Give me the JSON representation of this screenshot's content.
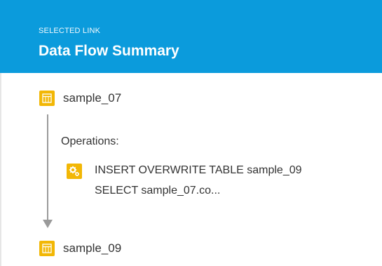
{
  "header": {
    "kicker": "SELECTED LINK",
    "title": "Data Flow Summary"
  },
  "source_table": {
    "name": "sample_07",
    "icon": "table-icon"
  },
  "operations": {
    "label": "Operations:",
    "items": [
      {
        "icon": "gears-icon",
        "line1": "INSERT OVERWRITE TABLE sample_09",
        "line2": "SELECT sample_07.co..."
      }
    ]
  },
  "target_table": {
    "name": "sample_09",
    "icon": "table-icon"
  },
  "colors": {
    "header_bg": "#0b9bdc",
    "icon_bg": "#f2b705",
    "flow_line": "#9a9a9a",
    "text": "#333333"
  }
}
